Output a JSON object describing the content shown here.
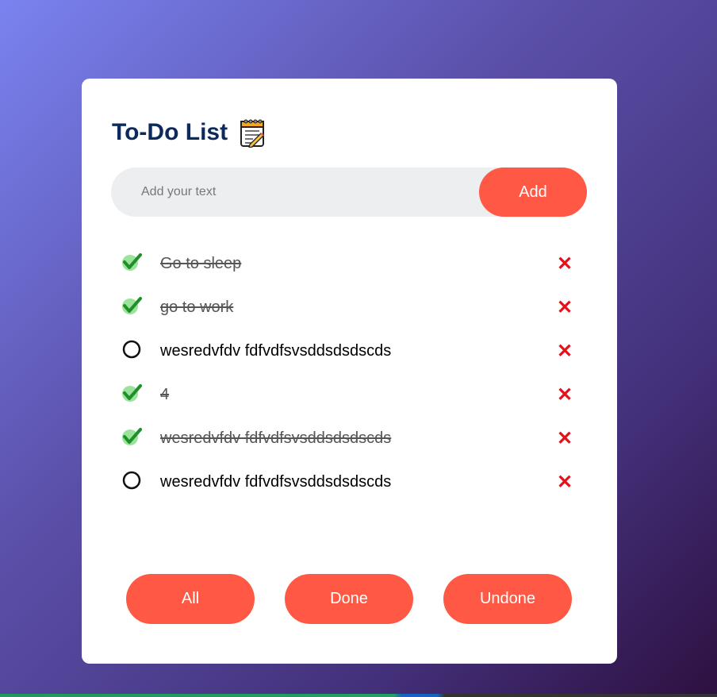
{
  "app": {
    "title": "To-Do List",
    "title_icon": "notepad-icon"
  },
  "input": {
    "placeholder": "Add your text",
    "value": "",
    "add_label": "Add"
  },
  "tasks": [
    {
      "text": "Go to sleep",
      "done": true
    },
    {
      "text": "go to work",
      "done": true
    },
    {
      "text": "wesredvfdv fdfvdfsvsddsdsdscds",
      "done": false
    },
    {
      "text": "4",
      "done": true
    },
    {
      "text": "wesredvfdv fdfvdfsvsddsdsdscds",
      "done": true
    },
    {
      "text": "wesredvfdv fdfvdfsvsddsdsdscds",
      "done": false
    }
  ],
  "delete_symbol": "✕",
  "filters": {
    "all_label": "All",
    "done_label": "Done",
    "undone_label": "Undone"
  },
  "colors": {
    "accent": "#ff5945",
    "title": "#0d2a5c",
    "delete": "#e5101a",
    "check_done": "#2ea83a"
  }
}
